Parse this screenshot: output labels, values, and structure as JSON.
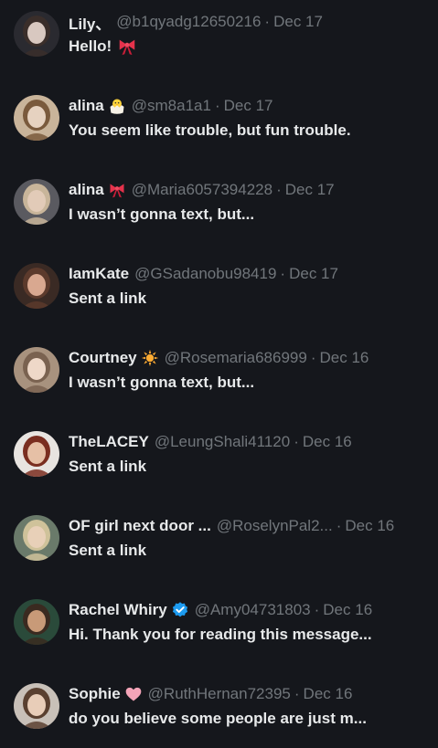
{
  "conversations": [
    {
      "name": "Lily、",
      "badge": "",
      "handle": "@b1qyadg12650216",
      "separator": "·",
      "date": "Dec 17",
      "preview": "Hello!",
      "preview_emoji": "ribbon-icon",
      "avatar_colors": [
        "#2a2a30",
        "#d8c8c0",
        "#3a2e2a"
      ]
    },
    {
      "name": "alina",
      "badge": "hatching-chick-icon",
      "handle": "@sm8a1a1",
      "separator": "·",
      "date": "Dec 17",
      "preview": "You seem like trouble, but fun trouble.",
      "preview_emoji": "",
      "avatar_colors": [
        "#c9b49a",
        "#e6d2c0",
        "#7a5a3c"
      ]
    },
    {
      "name": "alina",
      "badge": "ribbon-icon",
      "handle": "@Maria6057394228",
      "separator": "·",
      "date": "Dec 17",
      "preview": "I wasn’t gonna text, but...",
      "preview_emoji": "",
      "avatar_colors": [
        "#5a5a60",
        "#e2cbb8",
        "#c8b59a"
      ]
    },
    {
      "name": "IamKate",
      "badge": "",
      "handle": "@GSadanobu98419",
      "separator": "·",
      "date": "Dec 17",
      "preview": "Sent a link",
      "preview_emoji": "",
      "avatar_colors": [
        "#3a2a24",
        "#d9a890",
        "#5c3a2c"
      ]
    },
    {
      "name": "Courtney",
      "badge": "sun-icon",
      "handle": "@Rosemaria686999",
      "separator": "·",
      "date": "Dec 16",
      "preview": "I wasn’t gonna text, but...",
      "preview_emoji": "",
      "avatar_colors": [
        "#a8927e",
        "#eed8c8",
        "#7a6250"
      ]
    },
    {
      "name": "TheLACEY",
      "badge": "",
      "handle": "@LeungShali41120",
      "separator": "·",
      "date": "Dec 16",
      "preview": "Sent a link",
      "preview_emoji": "",
      "avatar_colors": [
        "#e8e4e0",
        "#e6c0a6",
        "#7a2e20"
      ]
    },
    {
      "name": "OF girl next door ...",
      "badge": "",
      "handle": "@RoselynPal2...",
      "separator": "·",
      "date": "Dec 16",
      "preview": "Sent a link",
      "preview_emoji": "",
      "avatar_colors": [
        "#6a7a6a",
        "#e8d0b8",
        "#cfc29a"
      ]
    },
    {
      "name": "Rachel Whiry",
      "badge": "verified-icon",
      "handle": "@Amy04731803",
      "separator": "·",
      "date": "Dec 16",
      "preview": "Hi. Thank you for reading this message...",
      "preview_emoji": "",
      "avatar_colors": [
        "#2a4a3a",
        "#c89a78",
        "#3a2a20"
      ]
    },
    {
      "name": "Sophie",
      "badge": "pink-heart-icon",
      "handle": "@RuthHernan72395",
      "separator": "·",
      "date": "Dec 16",
      "preview": "do you believe some people are just m...",
      "preview_emoji": "",
      "avatar_colors": [
        "#c8c0b8",
        "#e8cdb8",
        "#5a4030"
      ]
    }
  ]
}
